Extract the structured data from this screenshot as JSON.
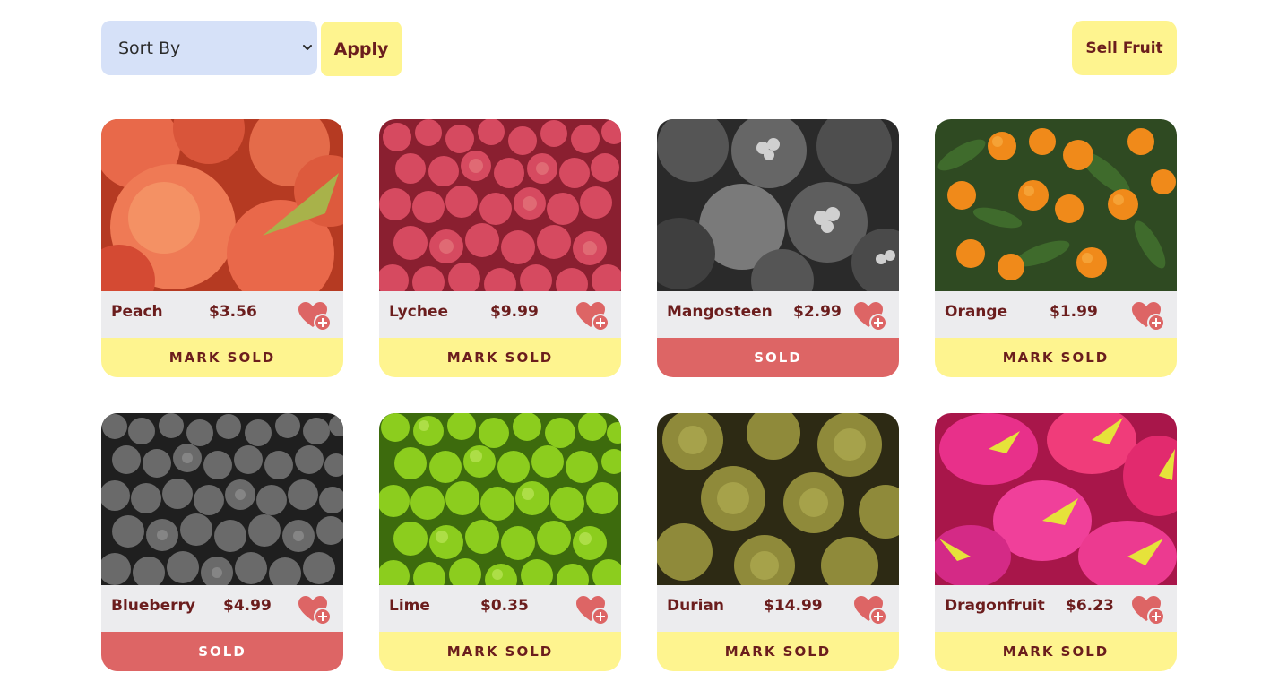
{
  "toolbar": {
    "sort_label": "Sort By",
    "apply_label": "Apply",
    "sell_label": "Sell Fruit"
  },
  "colors": {
    "accent_yellow": "#fef48f",
    "sold_red": "#dd6565",
    "text_maroon": "#6b1d1d",
    "select_blue": "#d6e1f8",
    "heart": "#dd6565"
  },
  "fruits": [
    {
      "name": "Peach",
      "price": "$3.56",
      "status": "MARK SOLD",
      "sold": false,
      "icon": "heart-plus-icon"
    },
    {
      "name": "Lychee",
      "price": "$9.99",
      "status": "MARK SOLD",
      "sold": false,
      "icon": "heart-plus-icon"
    },
    {
      "name": "Mangosteen",
      "price": "$2.99",
      "status": "SOLD",
      "sold": true,
      "icon": "heart-plus-icon"
    },
    {
      "name": "Orange",
      "price": "$1.99",
      "status": "MARK SOLD",
      "sold": false,
      "icon": "heart-plus-icon"
    },
    {
      "name": "Blueberry",
      "price": "$4.99",
      "status": "SOLD",
      "sold": true,
      "icon": "heart-plus-icon"
    },
    {
      "name": "Lime",
      "price": "$0.35",
      "status": "MARK SOLD",
      "sold": false,
      "icon": "heart-plus-icon"
    },
    {
      "name": "Durian",
      "price": "$14.99",
      "status": "MARK SOLD",
      "sold": false,
      "icon": "heart-plus-icon"
    },
    {
      "name": "Dragonfruit",
      "price": "$6.23",
      "status": "MARK SOLD",
      "sold": false,
      "icon": "heart-plus-icon"
    }
  ]
}
